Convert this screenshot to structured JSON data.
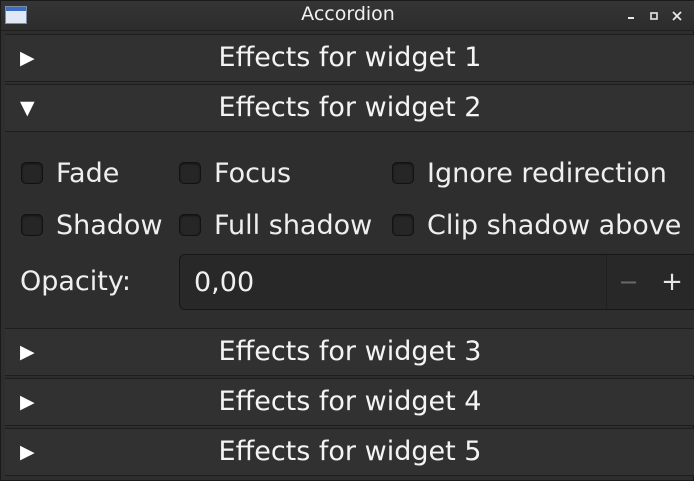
{
  "window": {
    "title": "Accordion",
    "minimize": "▁",
    "maximize": "▫",
    "close": "✕",
    "icon": "app-window-icon"
  },
  "sections": [
    {
      "label": "Effects for widget 1",
      "arrow": "▶",
      "expanded": false
    },
    {
      "label": "Effects for widget 2",
      "arrow": "▼",
      "expanded": true
    },
    {
      "label": "Effects for widget 3",
      "arrow": "▶",
      "expanded": false
    },
    {
      "label": "Effects for widget 4",
      "arrow": "▶",
      "expanded": false
    },
    {
      "label": "Effects for widget 5",
      "arrow": "▶",
      "expanded": false
    }
  ],
  "options": {
    "fade": {
      "label": "Fade",
      "checked": false
    },
    "focus": {
      "label": "Focus",
      "checked": false
    },
    "ignore_redirection": {
      "label": "Ignore redirection",
      "checked": false
    },
    "shadow": {
      "label": "Shadow",
      "checked": false
    },
    "full_shadow": {
      "label": "Full shadow",
      "checked": false
    },
    "clip_shadow_above": {
      "label": "Clip shadow above",
      "checked": false
    }
  },
  "opacity": {
    "label": "Opacity:",
    "value": "0,00",
    "decrement": "−",
    "increment": "+"
  }
}
